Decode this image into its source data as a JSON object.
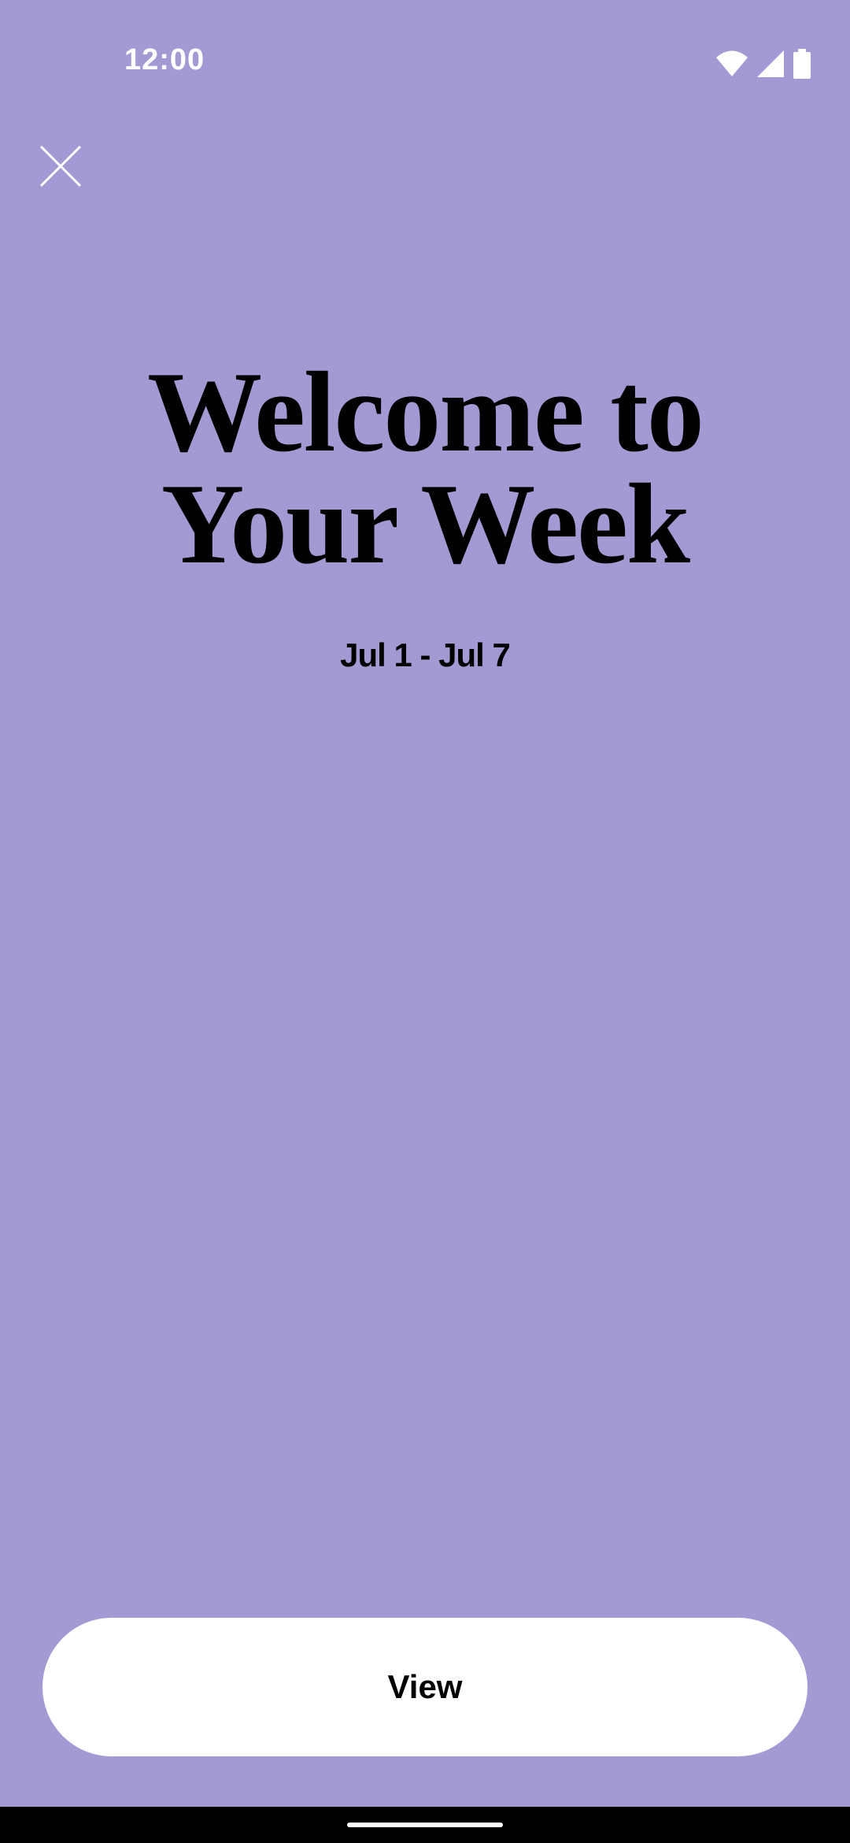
{
  "status_bar": {
    "time": "12:00",
    "icons": [
      "wifi-icon",
      "signal-icon",
      "battery-icon"
    ]
  },
  "close": {
    "icon": "close-icon"
  },
  "hero": {
    "title_line1": "Welcome to",
    "title_line2": "Your Week",
    "date_range": "Jul 1 - Jul 7"
  },
  "actions": {
    "view_label": "View"
  },
  "colors": {
    "background": "#a599d3",
    "button": "#ffffff",
    "text": "#000000",
    "nav_bar": "#000000"
  }
}
